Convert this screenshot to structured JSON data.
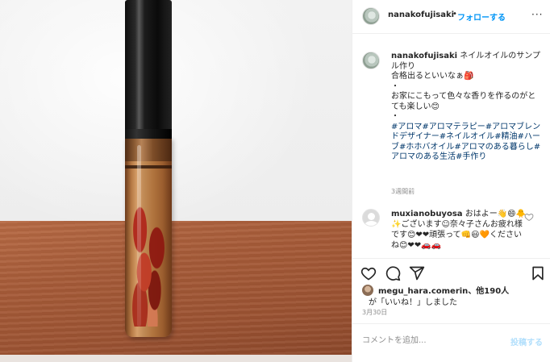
{
  "post": {
    "username": "nanakofujisaki",
    "follow_label": "フォローする",
    "separator": "•",
    "more_label": "···"
  },
  "caption": {
    "username": "nanakofujisaki",
    "text": " ネイルオイルのサンプル作り\n合格出るといいなぁ🎒\n・\nお家にこもって色々な香りを作るのがとても楽しい😊\n・\n",
    "hashtags": "#アロマ#アロマテラピー#アロマブレンドデザイナー#ネイルオイル#精油#ハーブ#ホホバオイル#アロマのある暮らし#アロマのある生活#手作り",
    "time_ago": "3週間前"
  },
  "comment": {
    "username": "muxianobuyosa",
    "text": " おはよー👋😄🐥✨ございます☺奈々子さんお疲れ様です😊❤❤頑張って👊😃🧡くださいね😊❤❤🚗🚗"
  },
  "actions": {
    "like_icon": "heart-icon",
    "comment_icon": "comment-icon",
    "share_icon": "share-icon",
    "save_icon": "bookmark-icon"
  },
  "likes": {
    "line1_user": "megu_hara.comerin",
    "line1_rest": "、他190人",
    "line2": "が「いいね！」しました"
  },
  "date": "3月30日",
  "add_comment": {
    "placeholder": "コメントを追加...",
    "post_label": "投稿する"
  },
  "colors": {
    "accent": "#0095f6",
    "hashtag": "#00376b",
    "post_disabled": "#b2dffc"
  }
}
